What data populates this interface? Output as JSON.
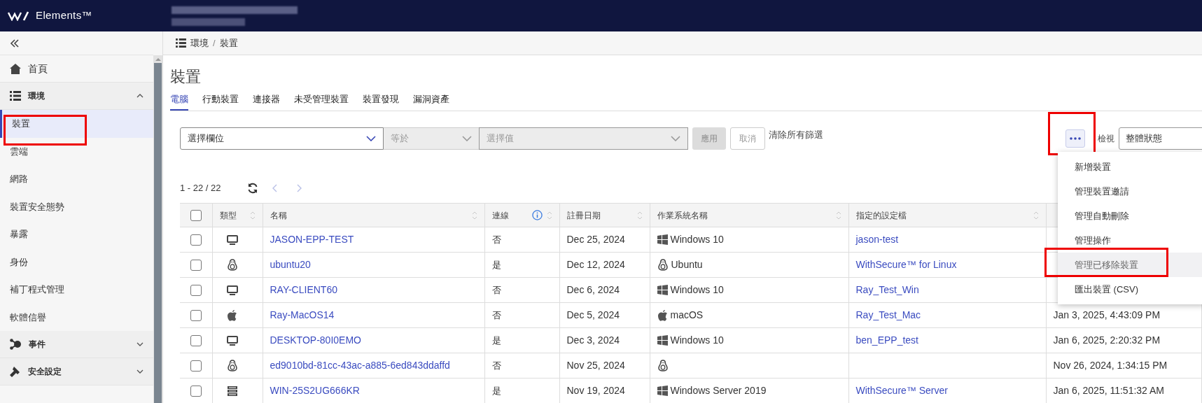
{
  "app": {
    "name": "Elements™"
  },
  "sidebar": {
    "items": [
      {
        "kind": "link",
        "label": "首頁"
      },
      {
        "kind": "section",
        "label": "環境",
        "expanded": true,
        "children": [
          {
            "label": "裝置",
            "selected": true,
            "highlighted": true
          },
          {
            "label": "雲端",
            "selected": false,
            "highlighted": false
          },
          {
            "label": "網路",
            "selected": false,
            "highlighted": false
          },
          {
            "label": "裝置安全態勢",
            "selected": false,
            "highlighted": false
          },
          {
            "label": "暴露",
            "selected": false,
            "highlighted": false
          },
          {
            "label": "身份",
            "selected": false,
            "highlighted": false
          },
          {
            "label": "補丁程式管理",
            "selected": false,
            "highlighted": false
          },
          {
            "label": "軟體信譽",
            "selected": false,
            "highlighted": false
          }
        ]
      },
      {
        "kind": "section",
        "label": "事件",
        "expanded": false
      },
      {
        "kind": "section",
        "label": "安全設定",
        "expanded": false
      }
    ]
  },
  "breadcrumb": {
    "items": [
      "環境",
      "裝置"
    ],
    "separator": "/"
  },
  "page_title": "裝置",
  "tabs": [
    {
      "label": "電腦",
      "selected": true
    },
    {
      "label": "行動裝置",
      "selected": false
    },
    {
      "label": "連接器",
      "selected": false
    },
    {
      "label": "未受管理裝置",
      "selected": false
    },
    {
      "label": "裝置發現",
      "selected": false
    },
    {
      "label": "漏洞資產",
      "selected": false
    }
  ],
  "filter": {
    "field": {
      "placeholder": "選擇欄位",
      "disabled": false
    },
    "operator": {
      "value": "等於",
      "disabled": true
    },
    "value": {
      "placeholder": "選擇值",
      "disabled": true
    },
    "buttons": [
      {
        "label": "應用",
        "kind": "primary",
        "disabled": true
      },
      {
        "label": "取消",
        "kind": "secondary",
        "disabled": true
      }
    ],
    "clear_link": "清除所有篩選"
  },
  "toolbar": {
    "more_button": {
      "highlighted": true
    },
    "view_label": "檢視",
    "view_select": "整體狀態"
  },
  "menu": {
    "items": [
      {
        "label": "新增裝置",
        "hovered": false,
        "highlighted": false
      },
      {
        "label": "管理裝置邀請",
        "hovered": false,
        "highlighted": false
      },
      {
        "label": "管理自動刪除",
        "hovered": false,
        "highlighted": false
      },
      {
        "label": "管理操作",
        "hovered": false,
        "highlighted": false
      },
      {
        "label": "管理已移除裝置",
        "hovered": true,
        "highlighted": true
      },
      {
        "label": "匯出裝置 (CSV)",
        "hovered": false,
        "highlighted": false
      }
    ]
  },
  "pagination": {
    "range": "1 - 22 / 22"
  },
  "table": {
    "all_selected": false,
    "columns": [
      {
        "label": "類型",
        "info": false
      },
      {
        "label": "名稱",
        "info": false
      },
      {
        "label": "連線",
        "info": true
      },
      {
        "label": "註冊日期",
        "info": false
      },
      {
        "label": "作業系統名稱",
        "info": false
      },
      {
        "label": "指定的設定檔",
        "info": false
      }
    ],
    "rows": [
      {
        "selected": false,
        "kind": "desktop",
        "name": "JASON-EPP-TEST",
        "connected": "否",
        "registered": "Dec 25, 2024",
        "os": {
          "kind": "windows",
          "name": "Windows 10"
        },
        "profile": "jason-test"
      },
      {
        "selected": false,
        "kind": "linux",
        "name": "ubuntu20",
        "connected": "是",
        "registered": "Dec 12, 2024",
        "os": {
          "kind": "linux",
          "name": "Ubuntu"
        },
        "profile": "WithSecure™ for Linux"
      },
      {
        "selected": false,
        "kind": "desktop",
        "name": "RAY-CLIENT60",
        "connected": "否",
        "registered": "Dec 6, 2024",
        "os": {
          "kind": "windows",
          "name": "Windows 10"
        },
        "profile": "Ray_Test_Win"
      },
      {
        "selected": false,
        "kind": "mac",
        "name": "Ray-MacOS14",
        "connected": "否",
        "registered": "Dec 5, 2024",
        "os": {
          "kind": "mac",
          "name": "macOS"
        },
        "profile": "Ray_Test_Mac",
        "column_8": "Jan 3, 2025, 4:43:09 PM"
      },
      {
        "selected": false,
        "kind": "desktop",
        "name": "DESKTOP-80I0EMO",
        "connected": "是",
        "registered": "Dec 3, 2024",
        "os": {
          "kind": "windows",
          "name": "Windows 10"
        },
        "profile": "ben_EPP_test",
        "column_8": "Jan 6, 2025, 2:20:32 PM"
      },
      {
        "selected": false,
        "kind": "linux",
        "name": "ed9010bd-81cc-43ac-a885-6ed843ddaffd",
        "connected": "否",
        "registered": "Nov 25, 2024",
        "os": {
          "kind": "linux"
        },
        "column_8": "Nov 26, 2024, 1:34:15 PM"
      },
      {
        "selected": false,
        "kind": "server",
        "name": "WIN-25S2UG666KR",
        "connected": "是",
        "registered": "Nov 19, 2024",
        "os": {
          "kind": "windows",
          "name": "Windows Server 2019"
        },
        "profile": "WithSecure™ Server",
        "column_8": "Jan 6, 2025, 11:51:32 AM"
      }
    ]
  }
}
